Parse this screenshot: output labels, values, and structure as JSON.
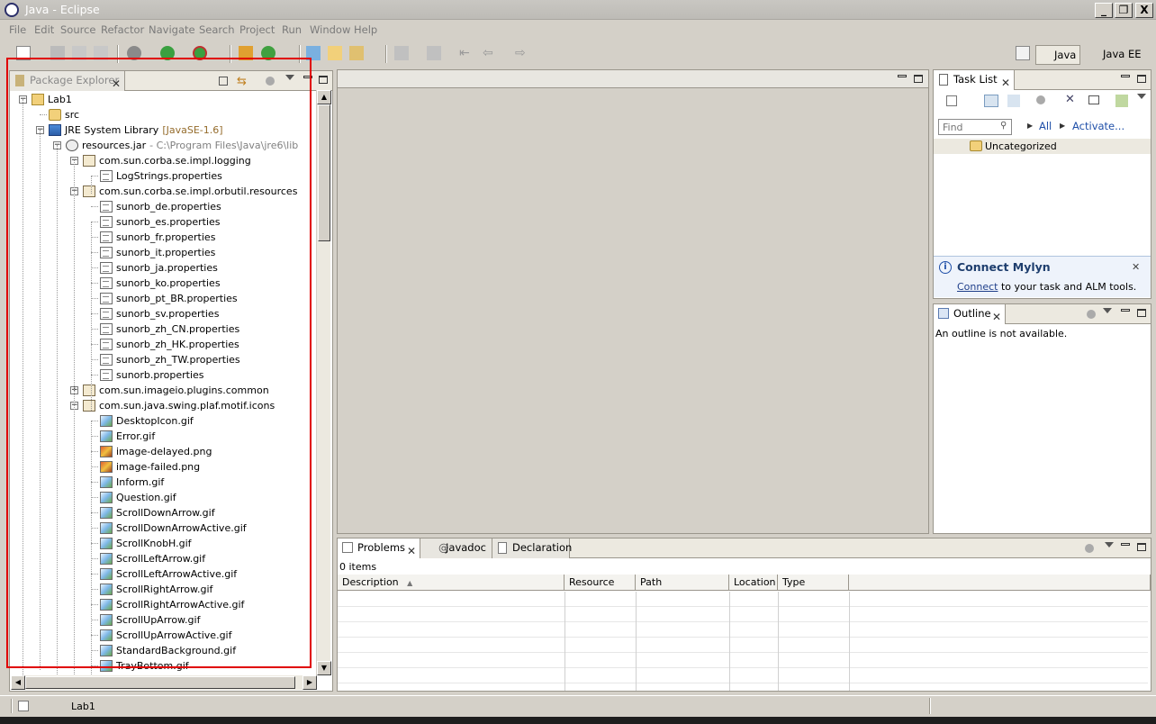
{
  "window": {
    "title": "Java - Eclipse",
    "minimize": "_",
    "maximize": "❐",
    "close": "X"
  },
  "menu": [
    "File",
    "Edit",
    "Source",
    "Refactor",
    "Navigate",
    "Search",
    "Project",
    "Run",
    "Window",
    "Help"
  ],
  "perspectives": [
    {
      "label": "Java",
      "active": true
    },
    {
      "label": "Java EE",
      "active": false
    }
  ],
  "package_explorer": {
    "tab_label": "Package Explorer",
    "tree": [
      {
        "label": "Lab1",
        "icon": "project-icon",
        "depth": 0,
        "expander": "−"
      },
      {
        "label": "src",
        "icon": "source-folder-icon",
        "depth": 1
      },
      {
        "label": "JRE System Library",
        "suffix": "[JavaSE-1.6]",
        "icon": "library-icon",
        "depth": 1,
        "expander": "−"
      },
      {
        "label": "resources.jar",
        "suffix": "- C:\\Program Files\\Java\\jre6\\lib",
        "icon": "jar-icon",
        "depth": 2,
        "expander": "−"
      },
      {
        "label": "com.sun.corba.se.impl.logging",
        "icon": "package-icon",
        "depth": 3,
        "expander": "−"
      },
      {
        "label": "LogStrings.properties",
        "icon": "properties-file-icon",
        "depth": 4
      },
      {
        "label": "com.sun.corba.se.impl.orbutil.resources",
        "icon": "package-icon",
        "depth": 3,
        "expander": "−"
      },
      {
        "label": "sunorb_de.properties",
        "icon": "properties-file-icon",
        "depth": 4
      },
      {
        "label": "sunorb_es.properties",
        "icon": "properties-file-icon",
        "depth": 4
      },
      {
        "label": "sunorb_fr.properties",
        "icon": "properties-file-icon",
        "depth": 4
      },
      {
        "label": "sunorb_it.properties",
        "icon": "properties-file-icon",
        "depth": 4
      },
      {
        "label": "sunorb_ja.properties",
        "icon": "properties-file-icon",
        "depth": 4
      },
      {
        "label": "sunorb_ko.properties",
        "icon": "properties-file-icon",
        "depth": 4
      },
      {
        "label": "sunorb_pt_BR.properties",
        "icon": "properties-file-icon",
        "depth": 4
      },
      {
        "label": "sunorb_sv.properties",
        "icon": "properties-file-icon",
        "depth": 4
      },
      {
        "label": "sunorb_zh_CN.properties",
        "icon": "properties-file-icon",
        "depth": 4
      },
      {
        "label": "sunorb_zh_HK.properties",
        "icon": "properties-file-icon",
        "depth": 4
      },
      {
        "label": "sunorb_zh_TW.properties",
        "icon": "properties-file-icon",
        "depth": 4
      },
      {
        "label": "sunorb.properties",
        "icon": "properties-file-icon",
        "depth": 4
      },
      {
        "label": "com.sun.imageio.plugins.common",
        "icon": "package-icon",
        "depth": 3,
        "expander": "+"
      },
      {
        "label": "com.sun.java.swing.plaf.motif.icons",
        "icon": "package-icon",
        "depth": 3,
        "expander": "−"
      },
      {
        "label": "DesktopIcon.gif",
        "icon": "image-file-icon",
        "depth": 4
      },
      {
        "label": "Error.gif",
        "icon": "image-file-icon",
        "depth": 4
      },
      {
        "label": "image-delayed.png",
        "icon": "png-file-icon",
        "depth": 4
      },
      {
        "label": "image-failed.png",
        "icon": "png-file-icon",
        "depth": 4
      },
      {
        "label": "Inform.gif",
        "icon": "image-file-icon",
        "depth": 4
      },
      {
        "label": "Question.gif",
        "icon": "image-file-icon",
        "depth": 4
      },
      {
        "label": "ScrollDownArrow.gif",
        "icon": "image-file-icon",
        "depth": 4
      },
      {
        "label": "ScrollDownArrowActive.gif",
        "icon": "image-file-icon",
        "depth": 4
      },
      {
        "label": "ScrollKnobH.gif",
        "icon": "image-file-icon",
        "depth": 4
      },
      {
        "label": "ScrollLeftArrow.gif",
        "icon": "image-file-icon",
        "depth": 4
      },
      {
        "label": "ScrollLeftArrowActive.gif",
        "icon": "image-file-icon",
        "depth": 4
      },
      {
        "label": "ScrollRightArrow.gif",
        "icon": "image-file-icon",
        "depth": 4
      },
      {
        "label": "ScrollRightArrowActive.gif",
        "icon": "image-file-icon",
        "depth": 4
      },
      {
        "label": "ScrollUpArrow.gif",
        "icon": "image-file-icon",
        "depth": 4
      },
      {
        "label": "ScrollUpArrowActive.gif",
        "icon": "image-file-icon",
        "depth": 4
      },
      {
        "label": "StandardBackground.gif",
        "icon": "image-file-icon",
        "depth": 4
      },
      {
        "label": "TrayBottom.gif",
        "icon": "image-file-icon",
        "depth": 4
      }
    ]
  },
  "task_list": {
    "tab_label": "Task List",
    "find_placeholder": "Find",
    "all_label": "All",
    "activate_label": "Activate...",
    "category": "Uncategorized",
    "mylyn_title": "Connect Mylyn",
    "mylyn_link": "Connect",
    "mylyn_text": " to your task and ALM tools."
  },
  "outline": {
    "tab_label": "Outline",
    "message": "An outline is not available."
  },
  "bottom_panel": {
    "tabs": [
      "Problems",
      "Javadoc",
      "Declaration"
    ],
    "items_count": "0 items",
    "columns": [
      "Description",
      "Resource",
      "Path",
      "Location",
      "Type"
    ]
  },
  "status": {
    "text": "Lab1"
  },
  "colors": {
    "highlight_box": "#e00000",
    "link": "#0000cc",
    "chrome": "#d4d0c8"
  }
}
